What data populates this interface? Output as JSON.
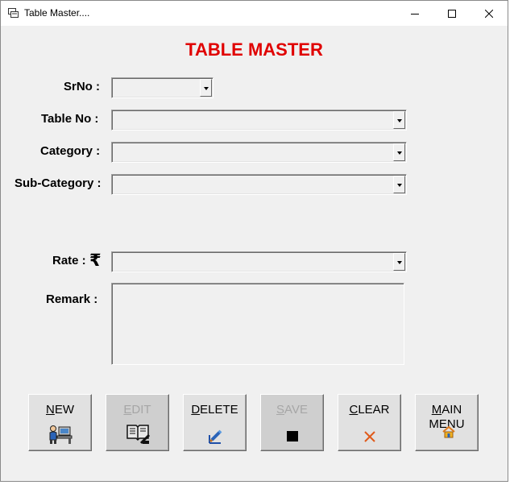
{
  "window": {
    "title": "Table Master....",
    "minimize_glyph": "minimize-icon",
    "maximize_glyph": "maximize-icon",
    "close_glyph": "close-icon"
  },
  "form": {
    "heading": "TABLE MASTER",
    "heading_color": "#e00000",
    "fields": {
      "srno_label": "SrNo :",
      "srno_value": "",
      "tableno_label": "Table No :",
      "tableno_value": "",
      "category_label": "Category :",
      "category_value": "",
      "subcategory_label": "Sub-Category :",
      "subcategory_value": "",
      "rate_label": "Rate :",
      "rate_symbol": "₹",
      "rate_value": "",
      "remark_label": "Remark :",
      "remark_value": ""
    }
  },
  "buttons": {
    "new": {
      "label_underlined": "N",
      "label_rest": "EW",
      "enabled": true,
      "icon": "person-at-desk-icon"
    },
    "edit": {
      "label_underlined": "E",
      "label_rest": "DIT",
      "enabled": false,
      "icon": "edit-book-icon"
    },
    "delete": {
      "label_underlined": "D",
      "label_rest": "ELETE",
      "enabled": true,
      "icon": "delete-pen-icon"
    },
    "save": {
      "label_underlined": "S",
      "label_rest": "AVE",
      "enabled": false,
      "icon": "save-icon"
    },
    "clear": {
      "label_underlined": "C",
      "label_rest": "LEAR",
      "enabled": true,
      "icon": "clear-x-icon"
    },
    "main_menu": {
      "line1_underlined": "M",
      "line1_rest": "AIN",
      "line2": "MENU",
      "enabled": true,
      "icon": "home-icon"
    }
  }
}
